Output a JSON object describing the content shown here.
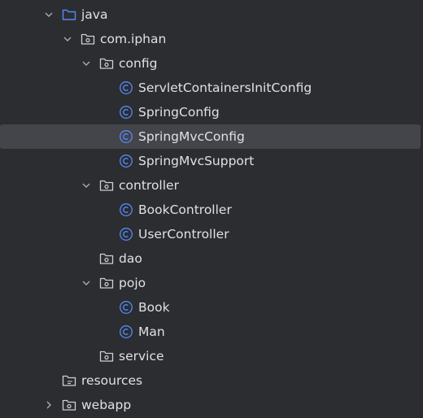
{
  "tree": {
    "items": [
      {
        "label": "java",
        "icon": "source-folder-icon",
        "chevron": "chevron-down-icon"
      },
      {
        "label": "com.iphan",
        "icon": "package-icon",
        "chevron": "chevron-down-icon"
      },
      {
        "label": "config",
        "icon": "package-icon",
        "chevron": "chevron-down-icon"
      },
      {
        "label": "ServletContainersInitConfig",
        "icon": "class-icon"
      },
      {
        "label": "SpringConfig",
        "icon": "class-icon"
      },
      {
        "label": "SpringMvcConfig",
        "icon": "class-icon",
        "selected": true
      },
      {
        "label": "SpringMvcSupport",
        "icon": "class-icon"
      },
      {
        "label": "controller",
        "icon": "package-icon",
        "chevron": "chevron-down-icon"
      },
      {
        "label": "BookController",
        "icon": "class-icon"
      },
      {
        "label": "UserController",
        "icon": "class-icon"
      },
      {
        "label": "dao",
        "icon": "package-icon"
      },
      {
        "label": "pojo",
        "icon": "package-icon",
        "chevron": "chevron-down-icon"
      },
      {
        "label": "Book",
        "icon": "class-icon"
      },
      {
        "label": "Man",
        "icon": "class-icon"
      },
      {
        "label": "service",
        "icon": "package-icon"
      },
      {
        "label": "resources",
        "icon": "resources-folder-icon"
      },
      {
        "label": "webapp",
        "icon": "web-folder-icon",
        "chevron": "chevron-right-icon"
      }
    ]
  },
  "colors": {
    "background": "#2b2d30",
    "selection": "#43454a",
    "text": "#dfe1e5",
    "source_folder_blue": "#548af7",
    "class_icon_blue": "#548af7",
    "folder_gray": "#ced0d6"
  }
}
